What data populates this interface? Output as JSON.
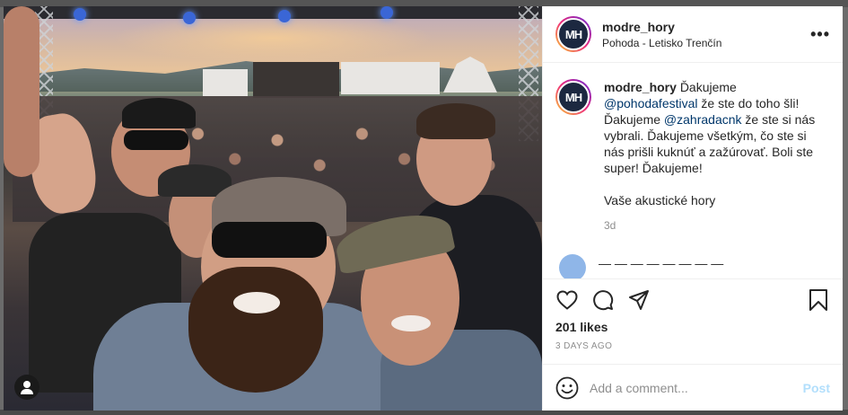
{
  "post": {
    "username": "modre_hory",
    "location": "Pohoda - Letisko Trenčín",
    "avatar_text": "MH",
    "more_label": "•••",
    "caption": {
      "username": "modre_hory",
      "part1": "Ďakujeme ",
      "mention1": "@pohodafestival",
      "part2": " že ste do toho šli! Ďakujeme ",
      "mention2": "@zahradacnk",
      "part3": " že ste si nás vybrali. Ďakujeme všetkým, čo ste si nás prišli kuknúť a zažúrovať. Boli ste super! Ďakujeme!",
      "signoff": "Vaše akustické hory",
      "time_ago": "3d"
    },
    "next_comment_preview": "— — — — — — — —",
    "likes": "201 likes",
    "date": "3 DAYS AGO",
    "comment_placeholder": "Add a comment...",
    "post_label": "Post"
  },
  "icons": [
    "heart-icon",
    "comment-icon",
    "share-icon",
    "bookmark-icon",
    "emoji-icon",
    "user-tag-icon",
    "more-icon"
  ],
  "colors": {
    "mention": "#00376b",
    "post_disabled": "#b2dffc",
    "muted": "#8e8e8e",
    "text": "#262626"
  }
}
